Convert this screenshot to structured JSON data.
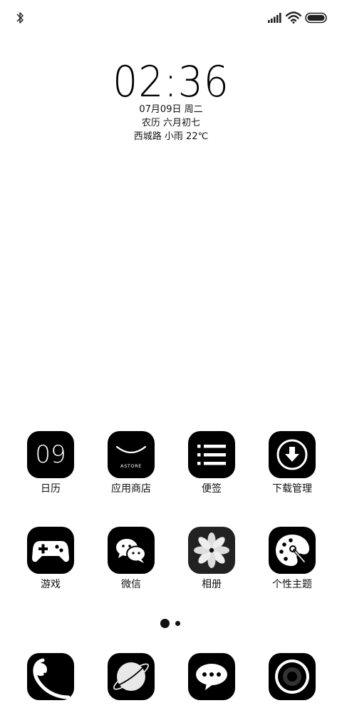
{
  "status_bar": {
    "icons": [
      "bluetooth-icon",
      "signal-icon",
      "wifi-icon",
      "battery-icon"
    ]
  },
  "clock_widget": {
    "time": "02:36",
    "date": "07月09日 周二",
    "lunar": "农历 六月初七",
    "weather": "西城路 小雨 22℃"
  },
  "apps": [
    {
      "label": "日历",
      "icon": "calendar-icon",
      "icon_text": "09"
    },
    {
      "label": "应用商店",
      "icon": "app-store-icon",
      "icon_text": "ASTORE"
    },
    {
      "label": "便签",
      "icon": "notes-icon"
    },
    {
      "label": "下载管理",
      "icon": "download-icon"
    },
    {
      "label": "游戏",
      "icon": "gamepad-icon"
    },
    {
      "label": "微信",
      "icon": "wechat-icon"
    },
    {
      "label": "相册",
      "icon": "gallery-icon"
    },
    {
      "label": "个性主题",
      "icon": "theme-palette-icon"
    }
  ],
  "page_indicator": {
    "pages": 2,
    "current": 1
  },
  "dock": [
    {
      "icon": "phone-icon"
    },
    {
      "icon": "browser-icon"
    },
    {
      "icon": "messages-icon"
    },
    {
      "icon": "camera-icon"
    }
  ],
  "colors": {
    "background": "#ffffff",
    "icon_bg": "#000000",
    "text": "#111111"
  }
}
